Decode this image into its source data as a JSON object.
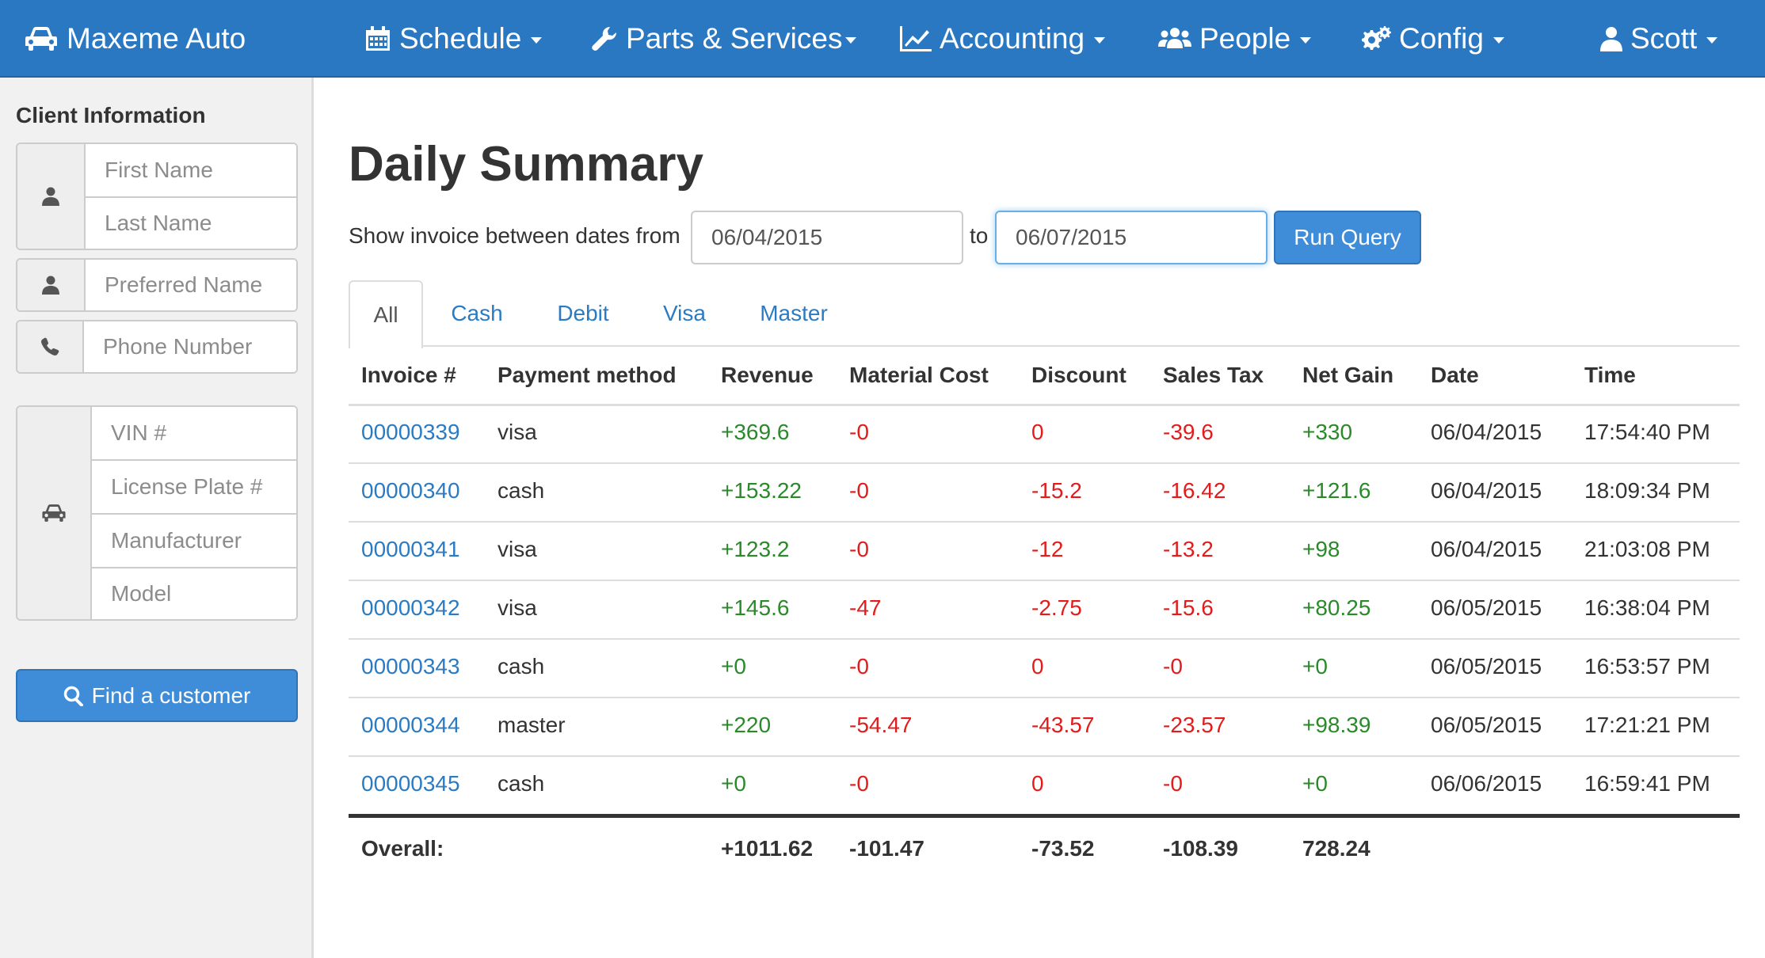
{
  "navbar": {
    "brand": "Maxeme Auto",
    "items": [
      {
        "label": "Schedule",
        "icon": "calendar-icon"
      },
      {
        "label": "Parts & Services",
        "icon": "wrench-icon"
      },
      {
        "label": "Accounting",
        "icon": "line-chart-icon"
      },
      {
        "label": "People",
        "icon": "users-icon"
      },
      {
        "label": "Config",
        "icon": "gears-icon"
      },
      {
        "label": "Scott",
        "icon": "user-icon"
      }
    ],
    "color": "#2b78c2"
  },
  "sidebar": {
    "title": "Client Information",
    "name_fields": {
      "first": "First Name",
      "last": "Last Name"
    },
    "preferred": "Preferred Name",
    "phone": "Phone Number",
    "vehicle_fields": {
      "vin": "VIN #",
      "plate": "License Plate #",
      "manufacturer": "Manufacturer",
      "model": "Model"
    },
    "find_button": "Find a customer"
  },
  "main": {
    "title": "Daily Summary",
    "query": {
      "label_from": "Show invoice between dates from",
      "from_value": "06/04/2015",
      "label_to": "to",
      "to_value": "06/07/2015",
      "run_button": "Run Query"
    },
    "tabs": [
      "All",
      "Cash",
      "Debit",
      "Visa",
      "Master"
    ],
    "active_tab": "All",
    "table": {
      "headers": [
        "Invoice #",
        "Payment method",
        "Revenue",
        "Material Cost",
        "Discount",
        "Sales Tax",
        "Net Gain",
        "Date",
        "Time"
      ],
      "rows": [
        [
          "00000339",
          "visa",
          "+369.6",
          "-0",
          "0",
          "-39.6",
          "+330",
          "06/04/2015",
          "17:54:40 PM"
        ],
        [
          "00000340",
          "cash",
          "+153.22",
          "-0",
          "-15.2",
          "-16.42",
          "+121.6",
          "06/04/2015",
          "18:09:34 PM"
        ],
        [
          "00000341",
          "visa",
          "+123.2",
          "-0",
          "-12",
          "-13.2",
          "+98",
          "06/04/2015",
          "21:03:08 PM"
        ],
        [
          "00000342",
          "visa",
          "+145.6",
          "-47",
          "-2.75",
          "-15.6",
          "+80.25",
          "06/05/2015",
          "16:38:04 PM"
        ],
        [
          "00000343",
          "cash",
          "+0",
          "-0",
          "0",
          "-0",
          "+0",
          "06/05/2015",
          "16:53:57 PM"
        ],
        [
          "00000344",
          "master",
          "+220",
          "-54.47",
          "-43.57",
          "-23.57",
          "+98.39",
          "06/05/2015",
          "17:21:21 PM"
        ],
        [
          "00000345",
          "cash",
          "+0",
          "-0",
          "0",
          "-0",
          "+0",
          "06/06/2015",
          "16:59:41 PM"
        ]
      ],
      "totals": {
        "label": "Overall:",
        "revenue": "+1011.62",
        "material": "-101.47",
        "discount": "-73.52",
        "tax": "-108.39",
        "net": "728.24"
      }
    },
    "colors": {
      "positive": "#2a8a2a",
      "negative": "#e31b1b",
      "link": "#2b7bc4"
    }
  }
}
